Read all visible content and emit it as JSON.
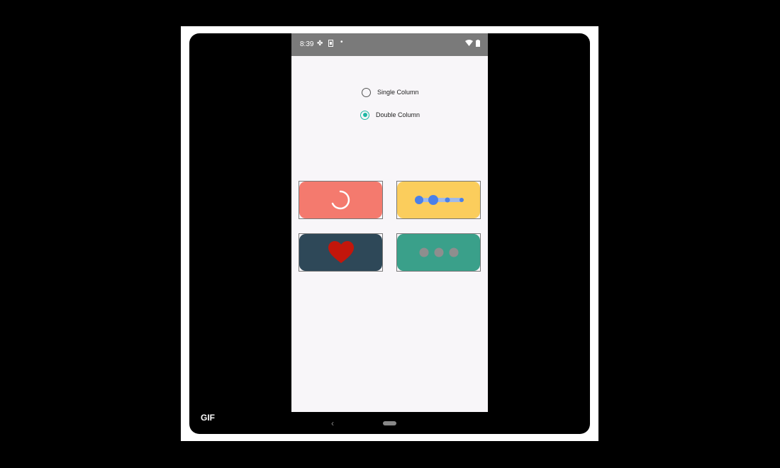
{
  "status_bar": {
    "time": "8:39",
    "icons": [
      "fan-icon",
      "sim-icon",
      "dot-icon",
      "wifi-icon",
      "battery-icon"
    ]
  },
  "layout_options": {
    "options": [
      {
        "label": "Single Column",
        "selected": false
      },
      {
        "label": "Double Column",
        "selected": true
      }
    ]
  },
  "cards": [
    {
      "name": "loading-spinner-card",
      "color": "#f47a6e",
      "icon": "spinner-arc-icon"
    },
    {
      "name": "dots-slider-card",
      "color": "#fbcd5c",
      "icon": "dots-slider-icon"
    },
    {
      "name": "heart-card",
      "color": "#2e4858",
      "icon": "heart-icon"
    },
    {
      "name": "three-dots-card",
      "color": "#3aa08a",
      "icon": "three-dots-icon"
    }
  ],
  "colors": {
    "accent": "#1fb8a4",
    "screen_bg": "#f8f6f9",
    "statusbar_bg": "#7a7a7a",
    "heart": "#c3160b",
    "slider_dot": "#4a80e8"
  },
  "overlay": {
    "badge": "GIF"
  },
  "nav": {
    "back_icon": "‹"
  }
}
